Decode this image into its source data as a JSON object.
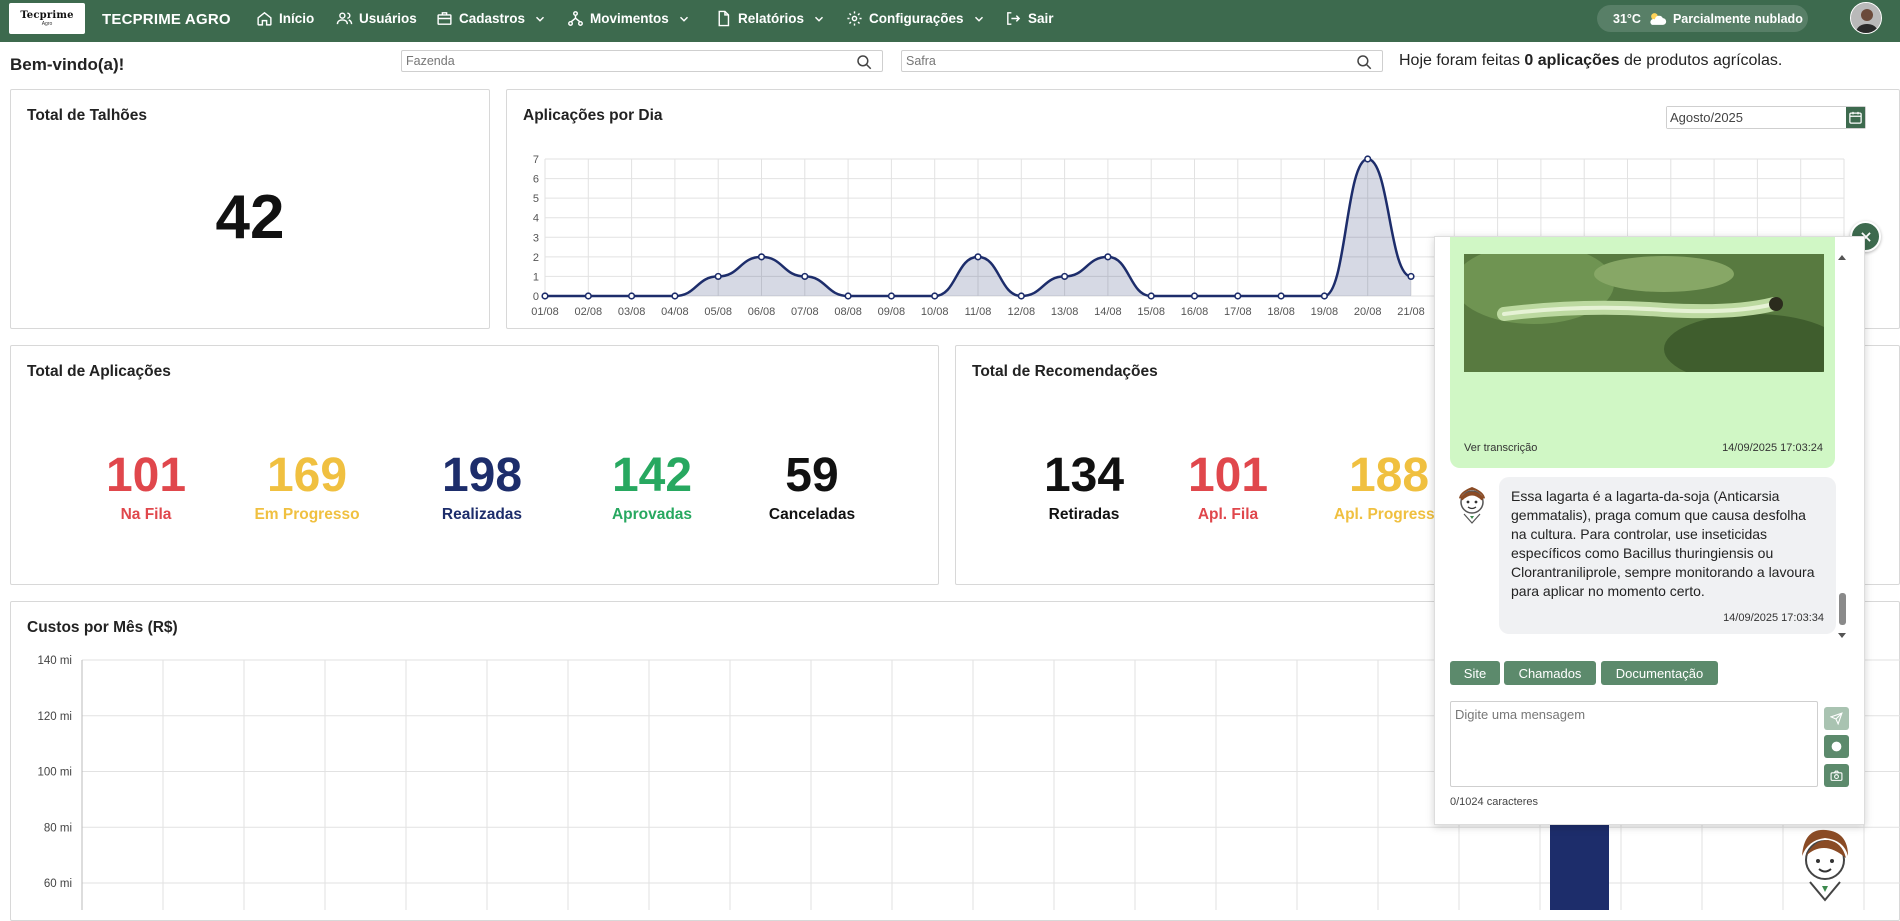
{
  "navbar": {
    "logo_main": "Tecprime",
    "logo_sub": "Agro",
    "brand": "TECPRIME AGRO",
    "items": [
      {
        "label": "Início",
        "icon": "home-icon"
      },
      {
        "label": "Usuários",
        "icon": "users-icon"
      },
      {
        "label": "Cadastros",
        "icon": "briefcase-icon"
      },
      {
        "label": "Movimentos",
        "icon": "network-icon"
      },
      {
        "label": "Relatórios",
        "icon": "file-icon"
      },
      {
        "label": "Configurações",
        "icon": "gear-icon"
      },
      {
        "label": "Sair",
        "icon": "logout-icon"
      }
    ],
    "weather": {
      "temp": "31°C",
      "desc": "Parcialmente nublado",
      "icon": "cloud-sun-icon"
    }
  },
  "toolbar": {
    "welcome": "Bem-vindo(a)!",
    "fazenda_placeholder": "Fazenda",
    "safra_placeholder": "Safra",
    "today_prefix": "Hoje foram feitas ",
    "today_count": "0 aplicações",
    "today_suffix": " de produtos agrícolas."
  },
  "talhoes": {
    "title": "Total de Talhões",
    "value": "42"
  },
  "aplicacoes_dia": {
    "title": "Aplicações por Dia",
    "month": "Agosto/2025"
  },
  "total_aplicacoes": {
    "title": "Total de Aplicações",
    "stats": [
      {
        "value": "101",
        "label": "Na Fila",
        "color": "#e0474c"
      },
      {
        "value": "169",
        "label": "Em Progresso",
        "color": "#f0c040"
      },
      {
        "value": "198",
        "label": "Realizadas",
        "color": "#1d2d6b"
      },
      {
        "value": "142",
        "label": "Aprovadas",
        "color": "#27a860"
      },
      {
        "value": "59",
        "label": "Canceladas",
        "color": "#111111"
      }
    ]
  },
  "total_recomendacoes": {
    "title": "Total de Recomendações",
    "stats": [
      {
        "value": "134",
        "label": "Retiradas",
        "color": "#111111"
      },
      {
        "value": "101",
        "label": "Apl. Fila",
        "color": "#e0474c"
      },
      {
        "value": "188",
        "label": "Apl. Progresso",
        "color": "#f0c040"
      }
    ]
  },
  "custos": {
    "title": "Custos por Mês (R$)"
  },
  "chart_data": [
    {
      "type": "area",
      "title": "Aplicações por Dia",
      "x": [
        "01/08",
        "02/08",
        "03/08",
        "04/08",
        "05/08",
        "06/08",
        "07/08",
        "08/08",
        "09/08",
        "10/08",
        "11/08",
        "12/08",
        "13/08",
        "14/08",
        "15/08",
        "16/08",
        "17/08",
        "18/08",
        "19/08",
        "20/08",
        "21/08"
      ],
      "values": [
        0,
        0,
        0,
        0,
        1,
        2,
        1,
        0,
        0,
        0,
        2,
        0,
        1,
        2,
        0,
        0,
        0,
        0,
        0,
        7,
        1
      ],
      "ylim": [
        0,
        7
      ],
      "yticks": [
        "0",
        "1",
        "2",
        "3",
        "4",
        "5",
        "6",
        "7"
      ],
      "grid": true,
      "color": "#1d2d6b"
    },
    {
      "type": "bar",
      "title": "Custos por Mês (R$)",
      "yticks": [
        "60 mi",
        "80 mi",
        "100 mi",
        "120 mi",
        "140 mi"
      ],
      "ylim": [
        60,
        140
      ],
      "grid": true,
      "color": "#1d2d6b"
    }
  ],
  "chat": {
    "ver_transcricao": "Ver transcrição",
    "user_ts": "14/09/2025 17:03:24",
    "bot_text": "Essa lagarta é a lagarta-da-soja (Anticarsia gemmatalis), praga comum que causa desfolha na cultura. Para controlar, use inseticidas específicos como Bacillus thuringiensis ou Clorantraniliprole, sempre monitorando a lavoura para aplicar no momento certo.",
    "bot_ts": "14/09/2025 17:03:34",
    "quick": [
      "Site",
      "Chamados",
      "Documentação"
    ],
    "placeholder": "Digite uma mensagem",
    "counter": "0/1024 caracteres"
  }
}
